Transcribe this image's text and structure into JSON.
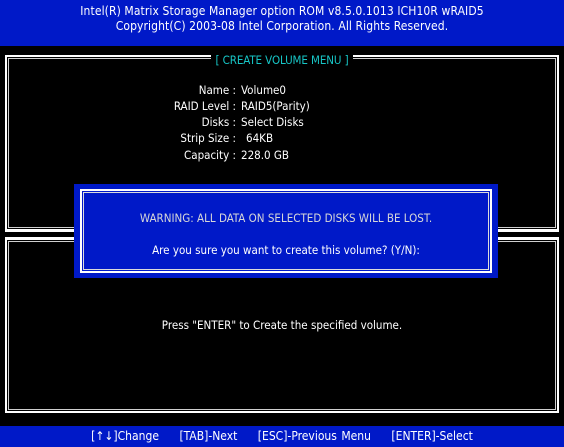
{
  "header": {
    "line1": "Intel(R) Matrix Storage Manager option ROM v8.5.0.1013 ICH10R wRAID5",
    "line2": "Copyright(C) 2003-08 Intel Corporation. All Rights Reserved."
  },
  "section": {
    "title": "[ CREATE VOLUME MENU ]"
  },
  "volume": {
    "fields": [
      {
        "label": "Name :",
        "value": "Volume0"
      },
      {
        "label": "RAID Level :",
        "value": "RAID5(Parity)"
      },
      {
        "label": "Disks :",
        "value": "Select Disks"
      },
      {
        "label": "Strip Size :",
        "value": "64KB"
      },
      {
        "label": "Capacity :",
        "value": "228.0  GB"
      }
    ]
  },
  "dialog": {
    "warning": "WARNING: ALL DATA ON SELECTED DISKS WILL BE LOST.",
    "confirm": "Are you sure you want to create this volume? (Y/N):"
  },
  "help": {
    "text": "Press \"ENTER\" to Create the specified volume."
  },
  "footer": {
    "keys": [
      "[↑↓]Change",
      "[TAB]-Next",
      "[ESC]-Previous Menu",
      "[ENTER]-Select"
    ]
  },
  "colors": {
    "background": "#000000",
    "accent_blue": "#0019c8",
    "title_cyan": "#17c6c6",
    "text": "#ffffff"
  }
}
